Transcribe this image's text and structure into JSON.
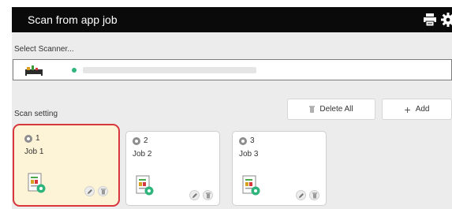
{
  "header": {
    "title": "Scan from app job",
    "icons": [
      "printer-icon",
      "gear-icon"
    ]
  },
  "scanner": {
    "label": "Select Scanner...",
    "status_color": "#2fb57b"
  },
  "scan_setting": {
    "label": "Scan setting",
    "delete_all_label": "Delete All",
    "add_label": "Add",
    "jobs": [
      {
        "number": "1",
        "name": "Job 1",
        "selected": true
      },
      {
        "number": "2",
        "name": "Job 2",
        "selected": false
      },
      {
        "number": "3",
        "name": "Job 3",
        "selected": false
      }
    ]
  },
  "colors": {
    "selected_border": "#d9363e",
    "selected_bg": "#fdf3d6",
    "titlebar": "#0a0a0a"
  }
}
